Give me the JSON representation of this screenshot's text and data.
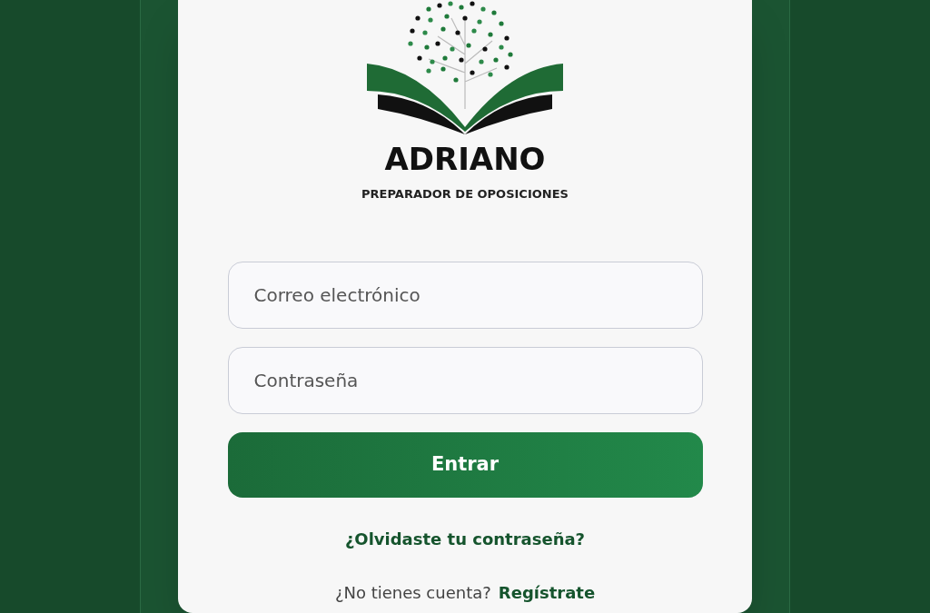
{
  "logo": {
    "title": "ADRIANO",
    "subtitle": "PREPARADOR DE OPOSICIONES"
  },
  "fields": [
    {
      "placeholder": "Correo electrónico"
    },
    {
      "placeholder": "Contraseña"
    }
  ],
  "submit": "Entrar",
  "forgot_link": "¿Olvidaste tu contraseña?",
  "signup": {
    "prompt": "¿No tienes cuenta?",
    "link": "Regístrate"
  }
}
